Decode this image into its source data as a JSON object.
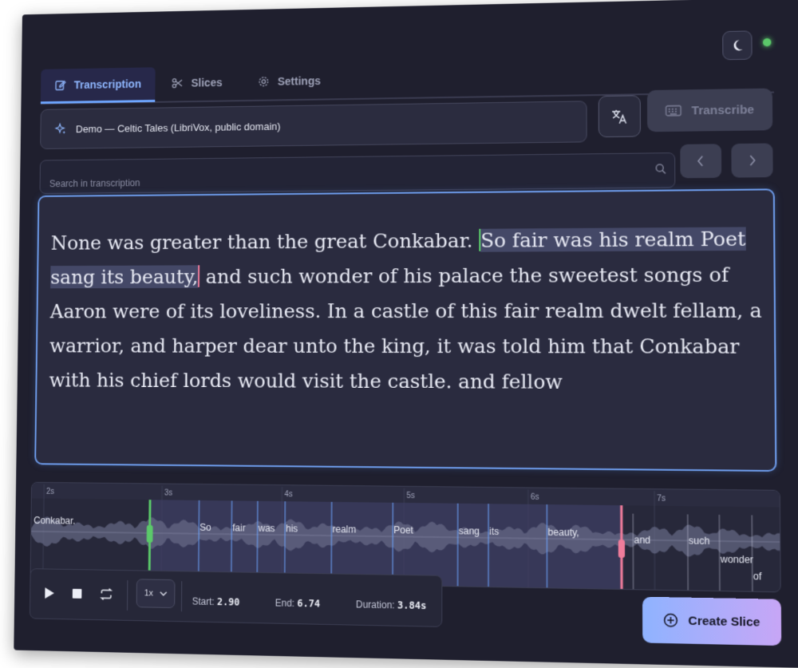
{
  "tabs": [
    {
      "label": "Transcription",
      "icon": "edit-icon",
      "active": true
    },
    {
      "label": "Slices",
      "icon": "scissors-icon",
      "active": false
    },
    {
      "label": "Settings",
      "icon": "gear-icon",
      "active": false
    }
  ],
  "source": {
    "label": "Demo — Celtic Tales (LibriVox, public domain)",
    "icon": "sparkle-icon"
  },
  "translate": {
    "icon": "translate-icon"
  },
  "transcribe": {
    "label": "Transcribe",
    "icon": "keyboard-icon",
    "disabled": true
  },
  "search": {
    "placeholder": "Search in transcription",
    "value": ""
  },
  "transcript": {
    "before": "None was greater than the great Conkabar. ",
    "selected": "So fair was his realm Poet sang its beauty,",
    "after": " and such wonder of his palace the sweetest songs of Aaron were of its loveliness. In a castle of this fair realm dwelt fellam, a warrior, and harper dear unto the king, it was told him that Conkabar with his chief lords would visit the castle. and fellow"
  },
  "waveform": {
    "ticks": [
      "2s",
      "3s",
      "4s",
      "5s",
      "6s",
      "7s"
    ],
    "words_outside": [
      "Conkabar.",
      "and",
      "such",
      "wonder",
      "of"
    ],
    "words_selected": [
      "So",
      "fair",
      "was",
      "his",
      "realm",
      "Poet",
      "sang",
      "its",
      "beauty,"
    ],
    "selection_start_s": 2.9,
    "selection_end_s": 6.74
  },
  "transport": {
    "speed": "1x",
    "start_label": "Start:",
    "start_value": "2.90",
    "end_label": "End:",
    "end_value": "6.74",
    "duration_label": "Duration:",
    "duration_value": "3.84s"
  },
  "create": {
    "label": "Create Slice",
    "icon": "plus-circle-icon"
  },
  "colors": {
    "accent": "#6ea6ff",
    "start_marker": "#5bc96a",
    "end_marker": "#ef7c9b",
    "selection": "#444867"
  }
}
